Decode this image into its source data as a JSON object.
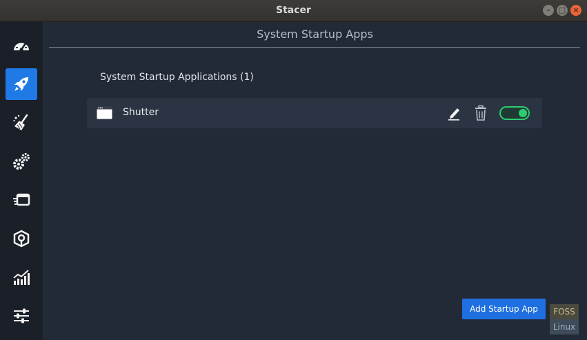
{
  "window": {
    "title": "Stacer",
    "controls": [
      "minimize-icon",
      "maximize-icon",
      "close-icon"
    ]
  },
  "sidebar": {
    "items": [
      {
        "icon": "dashboard-gauge-icon",
        "active": false
      },
      {
        "icon": "rocket-icon",
        "active": true
      },
      {
        "icon": "broom-cleaner-icon",
        "active": false
      },
      {
        "icon": "gears-services-icon",
        "active": false
      },
      {
        "icon": "processes-icon",
        "active": false
      },
      {
        "icon": "uninstaller-package-icon",
        "active": false
      },
      {
        "icon": "resources-chart-icon",
        "active": false
      },
      {
        "icon": "settings-sliders-icon",
        "active": false
      }
    ]
  },
  "main": {
    "page_title": "System Startup Apps",
    "section_title": "System Startup Applications (1)",
    "apps": [
      {
        "name": "Shutter",
        "enabled": true,
        "icon": "window-app-icon"
      }
    ],
    "add_button_label": "Add Startup App"
  },
  "watermark": {
    "top": "FOSS",
    "bottom": "Linux"
  },
  "colors": {
    "accent": "#1f7ae6",
    "toggle_on": "#2ecc71",
    "background": "#232a37",
    "sidebar": "#1b1f27"
  }
}
